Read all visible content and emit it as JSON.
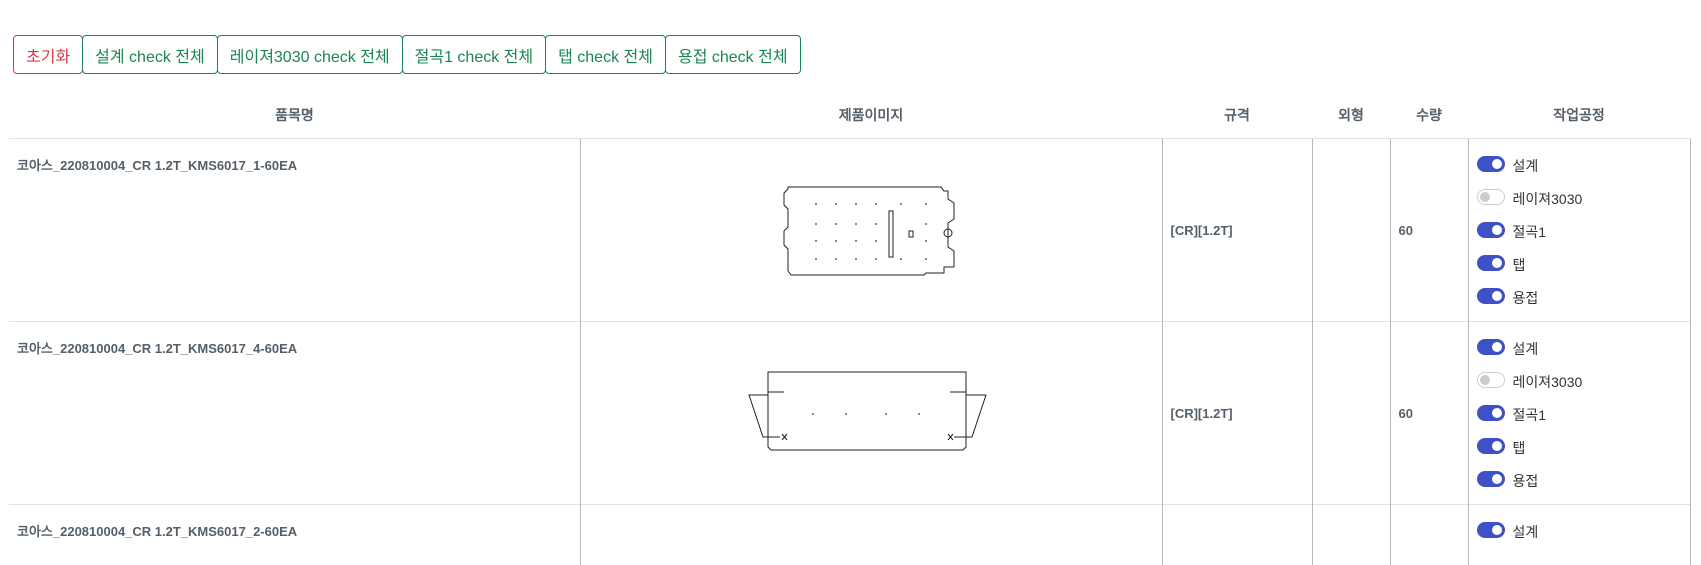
{
  "toolbar": {
    "buttons": [
      {
        "label": "초기화"
      },
      {
        "label": "설계 check 전체"
      },
      {
        "label": "레이져3030 check 전체"
      },
      {
        "label": "절곡1 check 전체"
      },
      {
        "label": "탭 check 전체"
      },
      {
        "label": "용접 check 전체"
      }
    ],
    "colors": {
      "danger": "#dc3545",
      "success": "#198754",
      "switch_on": "#3f51c6"
    }
  },
  "table": {
    "headers": [
      "품목명",
      "제품이미지",
      "규격",
      "외형",
      "수량",
      "작업공정"
    ],
    "rows": [
      {
        "name": "코아스_220810004_CR 1.2T_KMS6017_1-60EA",
        "spec": "[CR][1.2T]",
        "shape": "",
        "qty": "60",
        "processes": [
          {
            "label": "설계",
            "on": true
          },
          {
            "label": "레이져3030",
            "on": false
          },
          {
            "label": "절곡1",
            "on": true
          },
          {
            "label": "탭",
            "on": true
          },
          {
            "label": "용접",
            "on": true
          }
        ]
      },
      {
        "name": "코아스_220810004_CR 1.2T_KMS6017_4-60EA",
        "spec": "[CR][1.2T]",
        "shape": "",
        "qty": "60",
        "processes": [
          {
            "label": "설계",
            "on": true
          },
          {
            "label": "레이져3030",
            "on": false
          },
          {
            "label": "절곡1",
            "on": true
          },
          {
            "label": "탭",
            "on": true
          },
          {
            "label": "용접",
            "on": true
          }
        ]
      },
      {
        "name": "코아스_220810004_CR 1.2T_KMS6017_2-60EA",
        "spec": "",
        "shape": "",
        "qty": "",
        "processes": [
          {
            "label": "설계",
            "on": true
          }
        ]
      }
    ]
  }
}
